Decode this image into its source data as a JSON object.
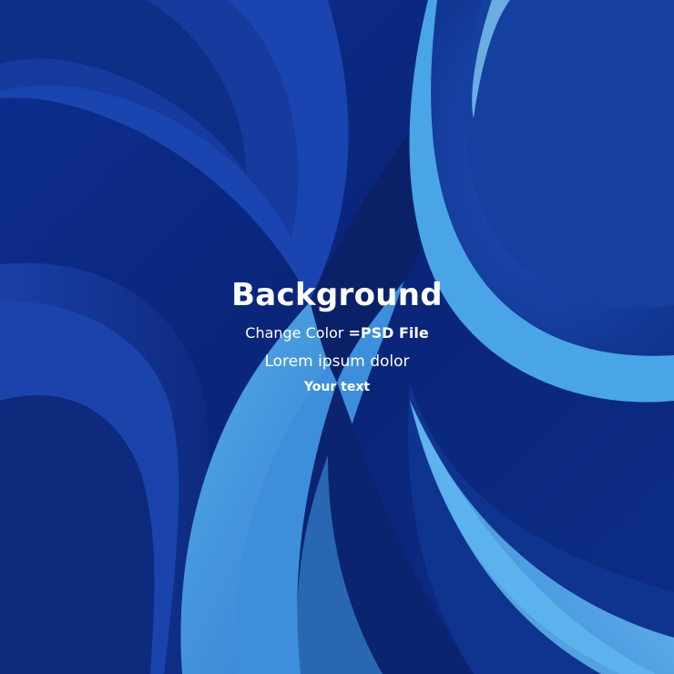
{
  "headline": {
    "title": "Background",
    "subtitle_part1": "Change Color ",
    "subtitle_part2": "=PSD File",
    "body": "Lorem ipsum dolor",
    "tagline": "Your text"
  },
  "colors": {
    "deep_navy": "#0a1d5e",
    "royal_blue": "#143fa8",
    "mid_blue": "#1f5fc4",
    "light_blue": "#3f9be0",
    "highlight_blue": "#8fd2f5"
  }
}
